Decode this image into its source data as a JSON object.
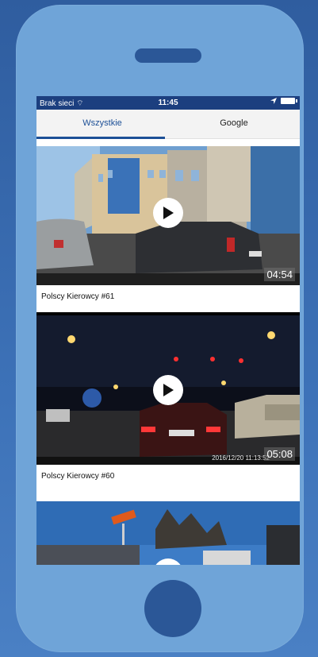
{
  "status_bar": {
    "carrier": "Brak sieci",
    "time": "11:45"
  },
  "tabs": [
    {
      "label": "Wszystkie",
      "active": true
    },
    {
      "label": "Google",
      "active": false
    }
  ],
  "videos": [
    {
      "title": "Polscy Kierowcy #61",
      "duration": "04:54",
      "date_stamp": ""
    },
    {
      "title": "Polscy Kierowcy #60",
      "duration": "05:08",
      "date_stamp": "2016/12/20 11:13:52"
    },
    {
      "title": "",
      "duration": "",
      "date_stamp": ""
    }
  ],
  "colors": {
    "background": "#3d72b8",
    "phone_body": "#6fa4d8",
    "phone_accent": "#2b5797",
    "status_bar": "#1c3f7f",
    "tab_active": "#1c4f96"
  }
}
